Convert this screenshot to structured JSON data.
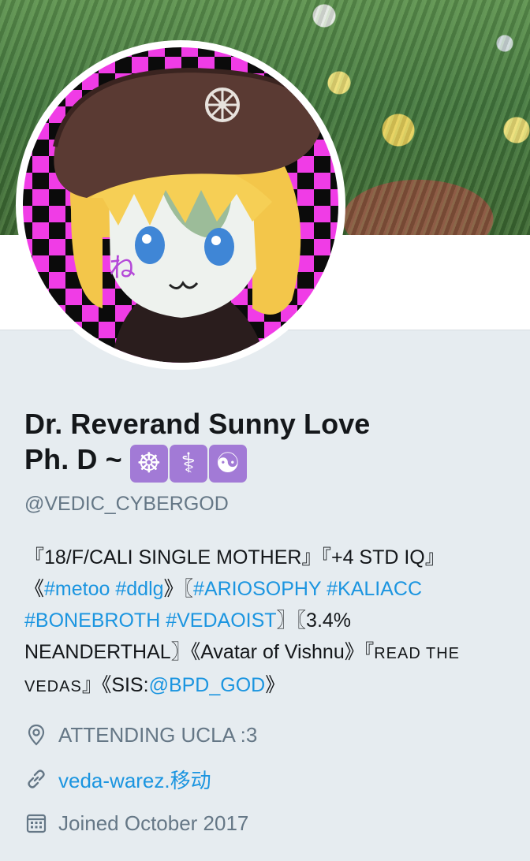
{
  "profile": {
    "name_line1": "Dr. Reverand Sunny Love",
    "name_line2": "Ph. D ~",
    "name_emojis": [
      {
        "icon": "dharma-wheel-icon",
        "glyph": "☸"
      },
      {
        "icon": "staff-of-aesculapius-icon",
        "glyph": "⚕"
      },
      {
        "icon": "yin-yang-icon",
        "glyph": "☯"
      }
    ],
    "handle": "@VEDIC_CYBERGOD",
    "bio": {
      "line1": "『18/F/CALI SINGLE MOTHER』『+4 STD IQ』",
      "open_1": "《",
      "tag_metoo": "#metoo",
      "tag_ddlg": "#ddlg",
      "close_open_2": "》〖",
      "tag_ariosophy": "#ARIOSOPHY",
      "tag_kaliacc": "#KALIACC",
      "tag_bonebroth": "#BONEBROTH",
      "tag_vedaoist": "#VEDAOIST",
      "mid_text": "〗〖3.4%",
      "line5": "NEANDERTHAL〗《Avatar of Vishnu》『",
      "read_the": "READ THE",
      "vedas": "VEDAS",
      "sis_text": "』《SIS:",
      "mention": "@BPD_GOD",
      "close_3": "》"
    },
    "location": "ATTENDING UCLA :3",
    "website": "veda-warez.移动",
    "joined": "Joined October 2017"
  },
  "colors": {
    "background": "#e6ecf0",
    "link": "#1b95e0",
    "secondary_text": "#657786",
    "emoji_tile": "#a27ad6"
  },
  "icons": {
    "location": "location-pin-icon",
    "website": "link-icon",
    "joined": "calendar-icon"
  }
}
